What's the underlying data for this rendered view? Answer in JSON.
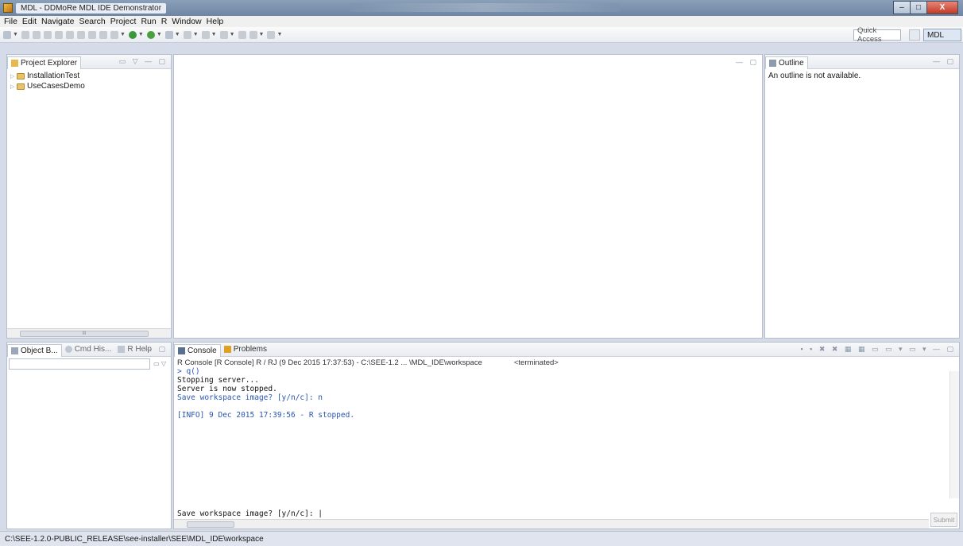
{
  "window": {
    "title": "MDL - DDMoRe MDL IDE Demonstrator",
    "minimize": "–",
    "maximize": "□",
    "close": "X"
  },
  "menu": [
    "File",
    "Edit",
    "Navigate",
    "Search",
    "Project",
    "Run",
    "R",
    "Window",
    "Help"
  ],
  "toolbar": {
    "quick_access_placeholder": "Quick Access",
    "perspective_label": "MDL"
  },
  "project_explorer": {
    "tab_label": "Project Explorer",
    "items": [
      "InstallationTest",
      "UseCasesDemo"
    ],
    "scroll_thumb": "III"
  },
  "outline": {
    "tab_label": "Outline",
    "message": "An outline is not available."
  },
  "bottom_left": {
    "tabs": [
      "Object B...",
      "Cmd His...",
      "R Help"
    ]
  },
  "console": {
    "tabs": [
      "Console",
      "Problems"
    ],
    "info": "R Console [R Console] R / RJ (9 Dec 2015 17:37:53) - C:\\SEE-1.2 ... \\MDL_IDE\\workspace",
    "status": "<terminated>",
    "lines": [
      {
        "text": "> q()",
        "color": "blue"
      },
      {
        "text": "Stopping server...",
        "color": "black"
      },
      {
        "text": "Server is now stopped.",
        "color": "black"
      },
      {
        "text": "Save workspace image? [y/n/c]: n",
        "color": "blue"
      },
      {
        "text": "",
        "color": "black"
      },
      {
        "text": "[INFO] 9 Dec 2015 17:39:56 - R stopped.",
        "color": "blue"
      }
    ],
    "prompt": "Save workspace image? [y/n/c]: |",
    "submit_label": "Submit"
  },
  "statusbar": {
    "path": "C:\\SEE-1.2.0-PUBLIC_RELEASE\\see-installer\\SEE\\MDL_IDE\\workspace"
  }
}
